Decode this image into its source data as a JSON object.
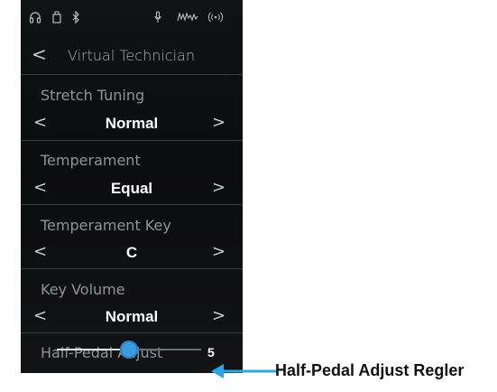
{
  "header": {
    "title": "Virtual Technician",
    "back_glyph": "<"
  },
  "status_icons": [
    "headphones-icon",
    "usb-icon",
    "bluetooth-icon",
    "microphone-icon",
    "midi-icon",
    "wireless-icon"
  ],
  "settings": [
    {
      "label": "Stretch Tuning",
      "value": "Normal"
    },
    {
      "label": "Temperament",
      "value": "Equal"
    },
    {
      "label": "Temperament Key",
      "value": "C"
    },
    {
      "label": "Key Volume",
      "value": "Normal"
    }
  ],
  "half_pedal": {
    "label": "Half-Pedal Adjust",
    "value": "5",
    "level_fraction": 0.5
  },
  "arrows": {
    "left": "<",
    "right": ">"
  },
  "callout": {
    "text": "Half-Pedal Adjust Regler"
  },
  "colors": {
    "accent": "#3a9be0",
    "background": "#0d0e10",
    "callout_line": "#2aa7e6"
  }
}
